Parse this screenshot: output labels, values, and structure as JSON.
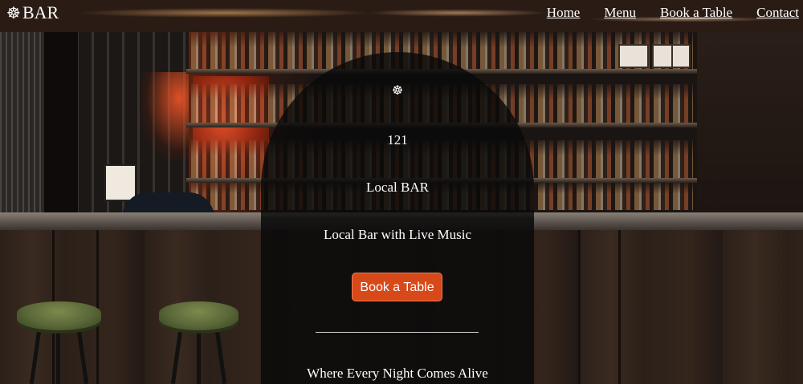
{
  "navbar": {
    "brand_icon": "ship-wheel-icon",
    "brand_glyph": "☸",
    "brand_text": "BAR",
    "links": [
      {
        "label": "Home"
      },
      {
        "label": "Menu"
      },
      {
        "label": "Book a Table"
      },
      {
        "label": "Contact"
      }
    ]
  },
  "hero": {
    "icon": "ship-wheel-icon",
    "icon_glyph": "☸",
    "number": "121",
    "title": "Local BAR",
    "subtitle": "Local Bar with Live Music",
    "cta_label": "Book a Table",
    "tagline": "Where Every Night Comes Alive"
  },
  "colors": {
    "cta_background": "#d8491a",
    "overlay": "#0a0a0a",
    "text": "#ffffff"
  }
}
